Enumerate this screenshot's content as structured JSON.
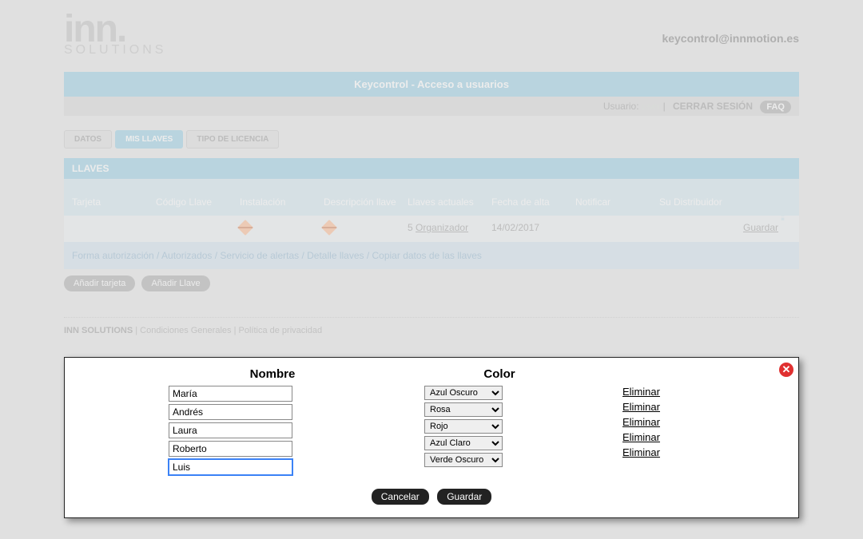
{
  "logo": {
    "main": "inn.",
    "sub": "SOLUTIONS"
  },
  "contact_email": "keycontrol@innmotion.es",
  "title_bar": "Keycontrol - Acceso a usuarios",
  "user_bar": {
    "prefix": "Usuario:",
    "logout": "CERRAR SESIÓN",
    "faq": "FAQ"
  },
  "tabs": {
    "datos": "DATOS",
    "mis_llaves": "MIS LLAVES",
    "tipo": "TIPO DE LICENCIA"
  },
  "section_title": "LLAVES",
  "columns": {
    "tarjeta": "Tarjeta",
    "codigo": "Código Llave",
    "instalacion": "Instalación",
    "descripcion": "Descripción llave",
    "actuales": "Llaves actuales",
    "fecha": "Fecha de alta",
    "notificar": "Notificar",
    "distribuidor": "Su Distribuidor"
  },
  "row": {
    "actuales_count": "5",
    "actuales_link": "Organizador",
    "fecha": "14/02/2017",
    "guardar": "Guardar"
  },
  "link_row": "Forma autorización / Autorizados / Servicio de alertas / Detalle llaves / Copiar datos de las llaves",
  "buttons": {
    "anadir_tarjeta": "Añadir tarjeta",
    "anadir_llave": "Añadir Llave"
  },
  "footer": {
    "brand": "INN SOLUTIONS",
    "sep": " | ",
    "cond": "Condiciones Generales",
    "priv": "Política de privacidad"
  },
  "modal": {
    "head_nombre": "Nombre",
    "head_color": "Color",
    "rows": [
      {
        "nombre": "María",
        "color": "Azul Oscuro"
      },
      {
        "nombre": "Andrés",
        "color": "Rosa"
      },
      {
        "nombre": "Laura",
        "color": "Rojo"
      },
      {
        "nombre": "Roberto",
        "color": "Azul Claro"
      },
      {
        "nombre": "Luis",
        "color": "Verde Oscuro"
      }
    ],
    "eliminar": "Eliminar",
    "cancelar": "Cancelar",
    "guardar": "Guardar"
  }
}
